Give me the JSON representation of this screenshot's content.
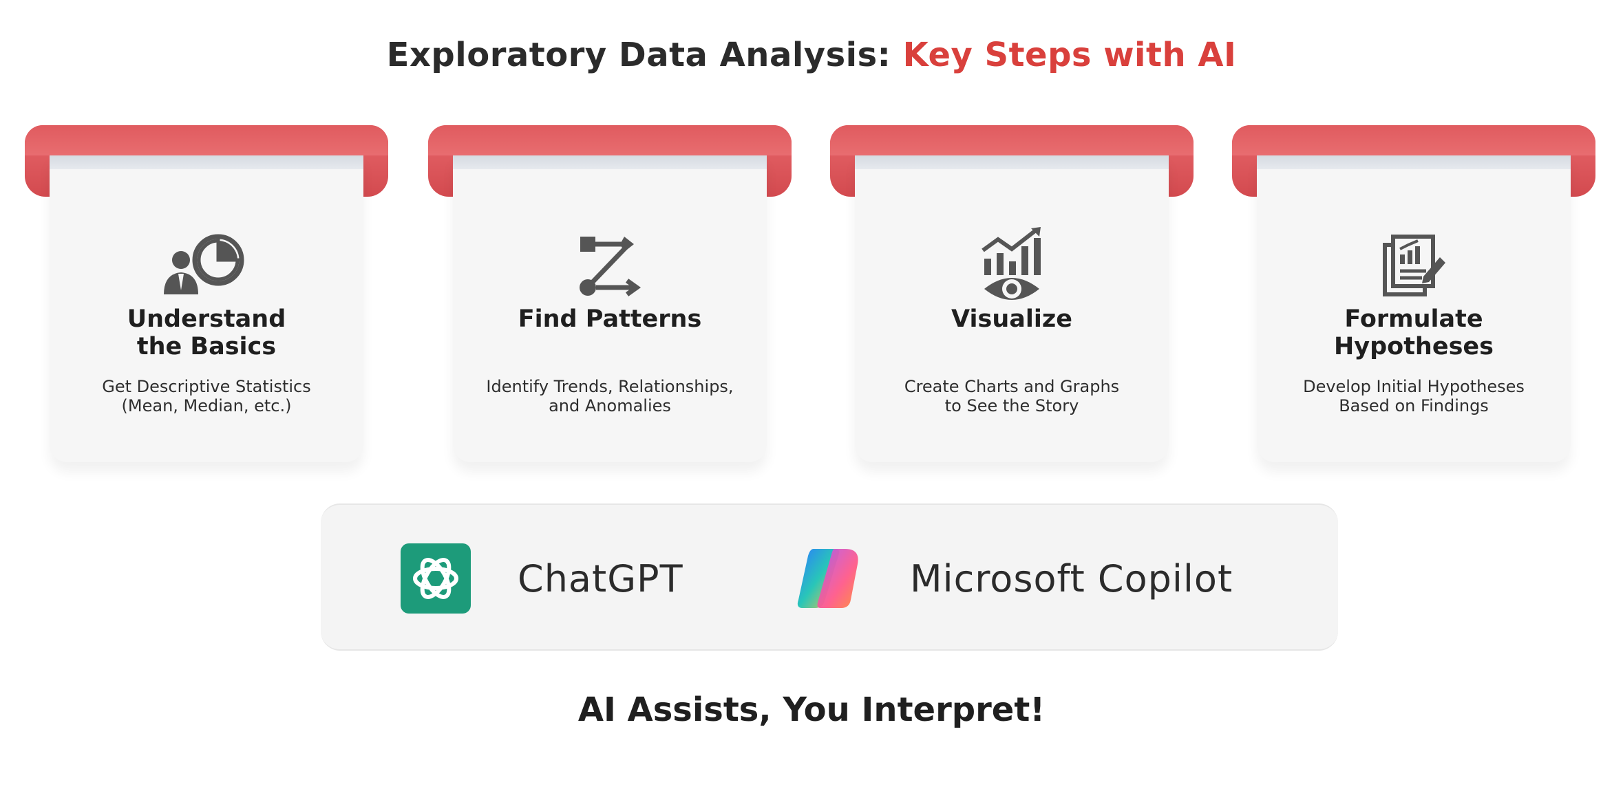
{
  "title": {
    "main": "Exploratory Data Analysis: ",
    "accent": "Key Steps with AI"
  },
  "colors": {
    "accent": "#d9403c",
    "card_band": "#e05b5f",
    "icon": "#555555",
    "chatgpt": "#1d9b7a"
  },
  "steps": [
    {
      "icon": "person-pie-chart-icon",
      "heading": "Understand\nthe Basics",
      "description": "Get Descriptive Statistics\n(Mean, Median, etc.)"
    },
    {
      "icon": "pattern-flow-icon",
      "heading": "Find Patterns",
      "description": "Identify Trends, Relationships,\nand Anomalies"
    },
    {
      "icon": "chart-eye-icon",
      "heading": "Visualize",
      "description": "Create Charts and Graphs\nto See the Story"
    },
    {
      "icon": "report-pen-icon",
      "heading": "Formulate\nHypotheses",
      "description": "Develop Initial Hypotheses\nBased on Findings"
    }
  ],
  "tools": [
    {
      "icon": "chatgpt-logo-icon",
      "name": "ChatGPT"
    },
    {
      "icon": "copilot-logo-icon",
      "name": "Microsoft Copilot"
    }
  ],
  "tagline": "AI Assists, You Interpret!"
}
